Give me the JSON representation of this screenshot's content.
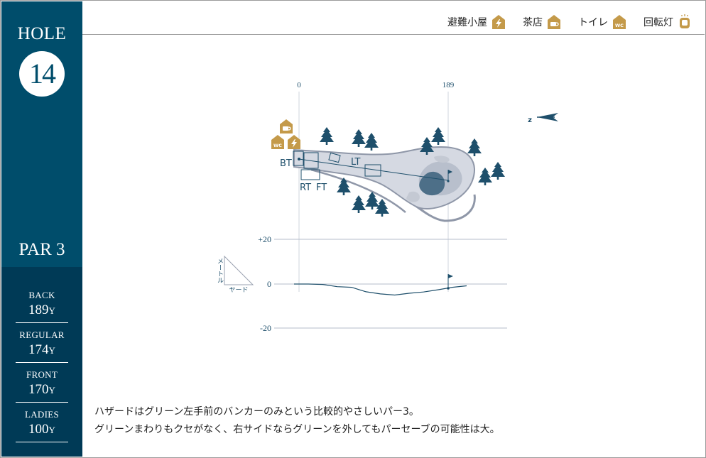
{
  "hole": {
    "label": "HOLE",
    "number": "14",
    "par": "PAR 3"
  },
  "tees": [
    {
      "name": "BACK",
      "distance": "189",
      "unit": "Y"
    },
    {
      "name": "REGULAR",
      "distance": "174",
      "unit": "Y"
    },
    {
      "name": "FRONT",
      "distance": "170",
      "unit": "Y"
    },
    {
      "name": "LADIES",
      "distance": "100",
      "unit": "Y"
    }
  ],
  "legend": [
    {
      "label": "避難小屋",
      "icon": "lightning-house-icon"
    },
    {
      "label": "茶店",
      "icon": "teacup-house-icon"
    },
    {
      "label": "トイレ",
      "icon": "wc-house-icon"
    },
    {
      "label": "回転灯",
      "icon": "rotating-light-icon"
    }
  ],
  "colors": {
    "sidebar": "#004d6b",
    "sidebar_dark": "#003a56",
    "accent_gold": "#c49a4a",
    "course_dark": "#1e4f6b",
    "fairway": "#d5d9e2"
  },
  "map": {
    "distance_start": "0",
    "distance_end": "189",
    "north": "N",
    "tee_labels": {
      "bt": "BT",
      "lt": "LT",
      "rt": "RT",
      "ft": "FT"
    },
    "map_icons": [
      "teacup-house-icon",
      "wc-house-icon",
      "lightning-house-icon"
    ]
  },
  "elevation": {
    "ticks": [
      "+20",
      "0",
      "-20"
    ],
    "ylabel": "メートル",
    "xlabel": "ヤード",
    "profile_meters_rel": [
      0,
      0,
      -0.2,
      -1.2,
      -1.5,
      -3.5,
      -4.5,
      -5.0,
      -4.2,
      -3.6,
      -2.6,
      -1.5,
      -0.8
    ]
  },
  "description": {
    "line1": "ハザードはグリーン左手前のバンカーのみという比較的やさしいパー3。",
    "line2": "グリーンまわりもクセがなく、右サイドならグリーンを外してもパーセーブの可能性は大。"
  }
}
